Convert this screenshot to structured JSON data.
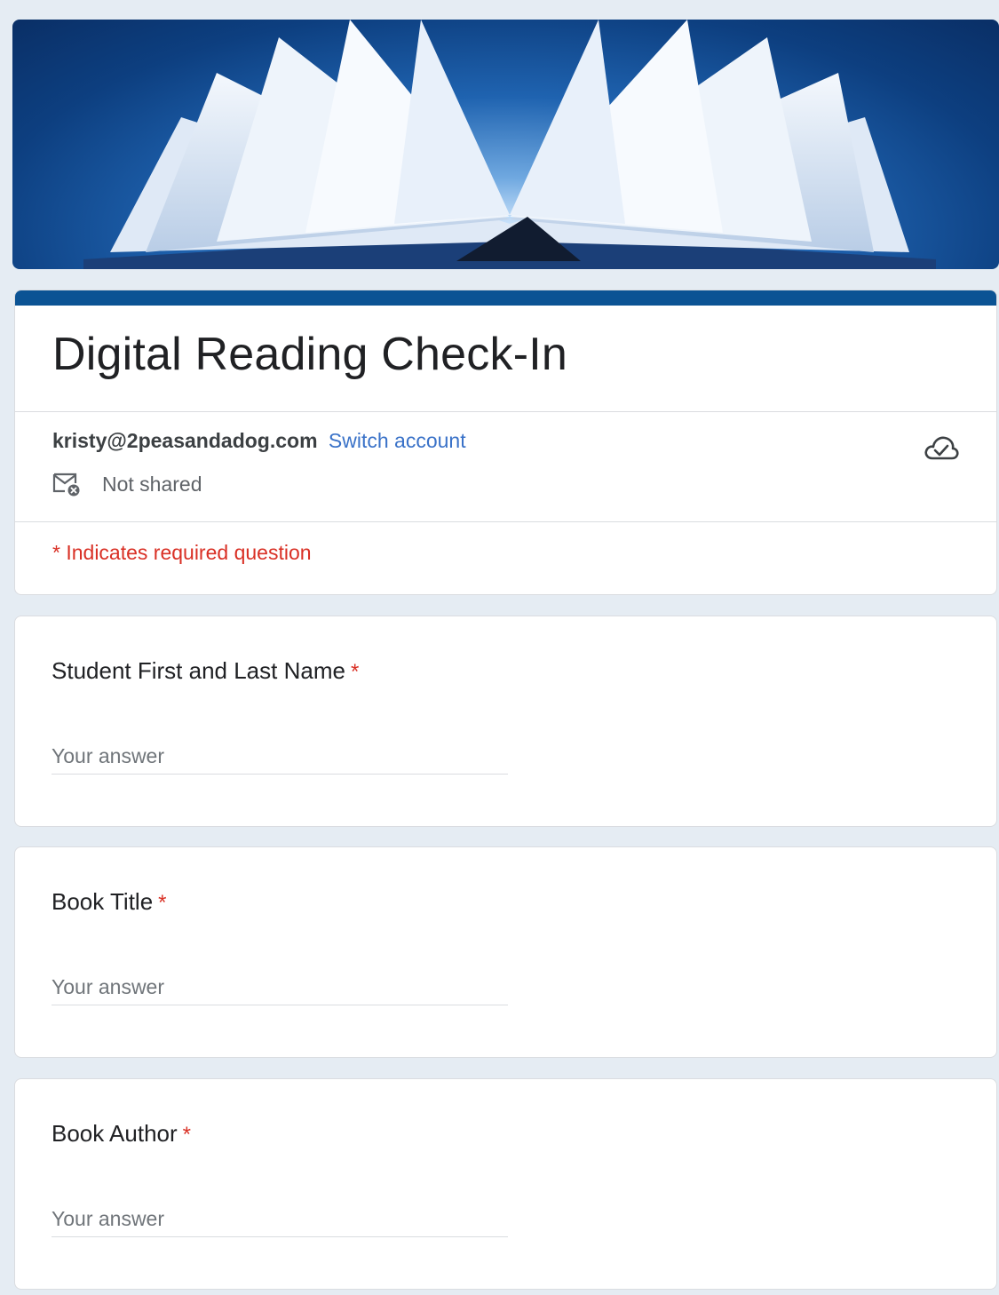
{
  "form": {
    "title": "Digital Reading Check-In",
    "account_email": "kristy@2peasandadog.com",
    "switch_account_label": "Switch account",
    "sharing_status": "Not shared",
    "required_note": "* Indicates required question"
  },
  "questions": [
    {
      "label": "Student First and Last Name",
      "required_mark": "*",
      "placeholder": "Your answer"
    },
    {
      "label": "Book Title",
      "required_mark": "*",
      "placeholder": "Your answer"
    },
    {
      "label": "Book Author",
      "required_mark": "*",
      "placeholder": "Your answer"
    }
  ],
  "colors": {
    "accent": "#0b5394",
    "background": "#e5ecf3",
    "required": "#d93025",
    "link": "#3a72c8"
  },
  "icons": {
    "cloud": "cloud-check-icon",
    "mail": "mail-not-shared-icon",
    "header": "open-book-header-image"
  }
}
